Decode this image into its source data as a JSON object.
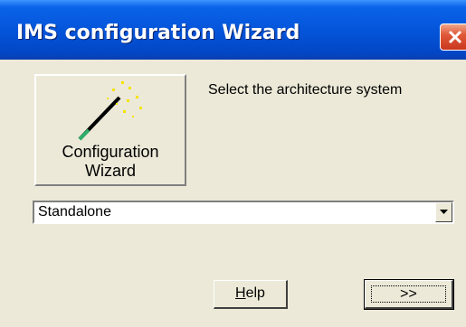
{
  "window": {
    "title": "IMS configuration Wizard"
  },
  "wizard_panel": {
    "label_line1": "Configuration",
    "label_line2": "Wizard"
  },
  "instruction": "Select the architecture system",
  "architecture_select": {
    "selected_value": "Standalone"
  },
  "buttons": {
    "help_label_mnemonic": "H",
    "help_label_rest": "elp",
    "next_label": ">>"
  },
  "colors": {
    "titlebar": "#0453d8",
    "dialog_background": "#ece9d8",
    "close_button": "#e0593a"
  },
  "icons": {
    "close": "close-icon",
    "wand": "magic-wand-icon",
    "dropdown": "chevron-down-icon"
  }
}
